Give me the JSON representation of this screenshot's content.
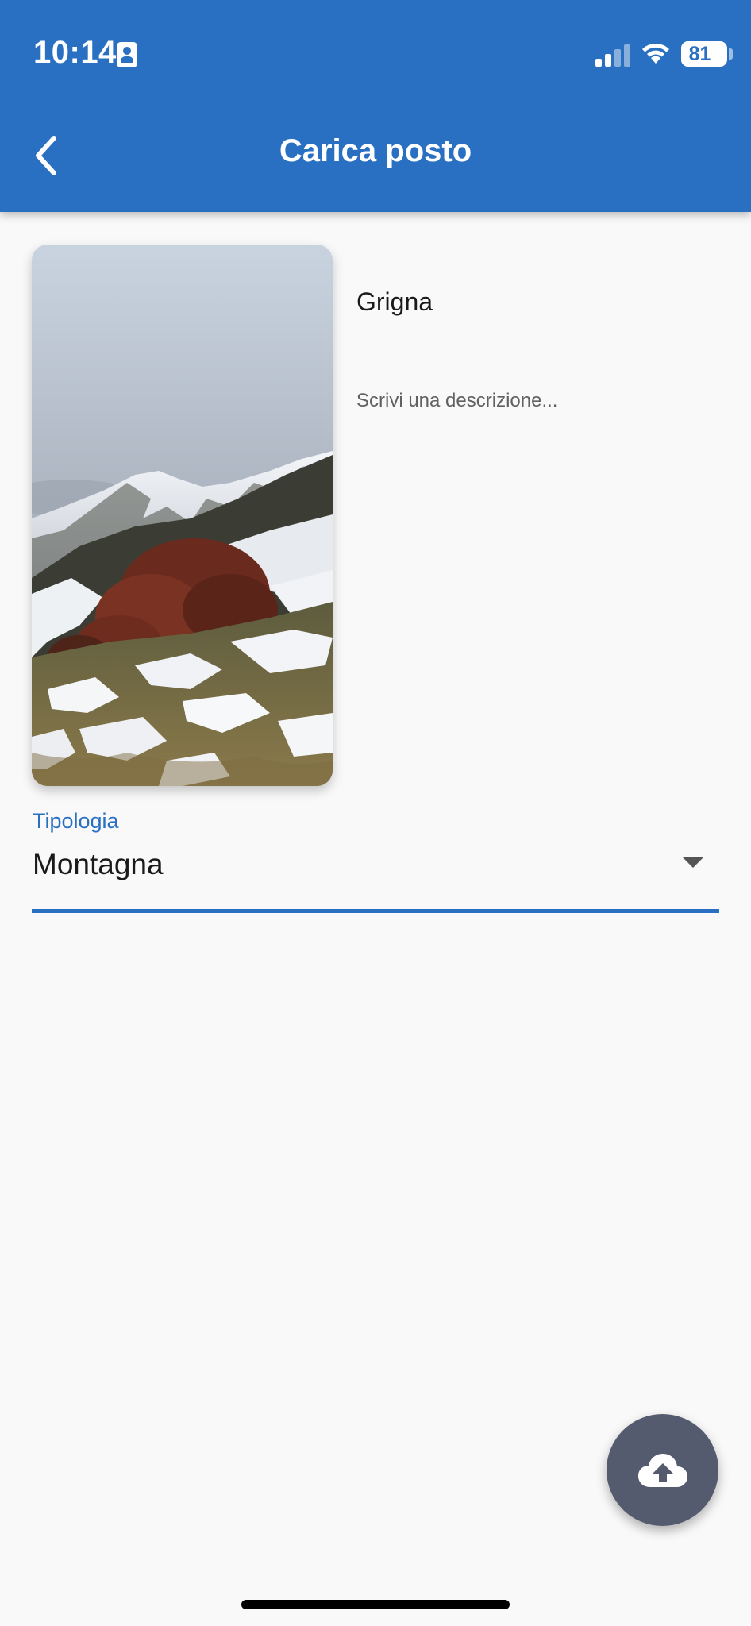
{
  "status_bar": {
    "time": "10:14",
    "battery": "81",
    "icons": [
      "contact-badge-icon",
      "signal-icon",
      "wifi-icon",
      "battery-icon"
    ]
  },
  "appbar": {
    "title": "Carica posto",
    "back_icon": "chevron-left-icon",
    "background_color": "#2970c2"
  },
  "form": {
    "name_value": "Grigna",
    "description_placeholder": "Scrivi una descrizione...",
    "type_label": "Tipologia",
    "type_value": "Montagna",
    "accent_color": "#2970c2"
  },
  "fab": {
    "icon": "cloud-upload-icon",
    "color": "#555b6f"
  }
}
